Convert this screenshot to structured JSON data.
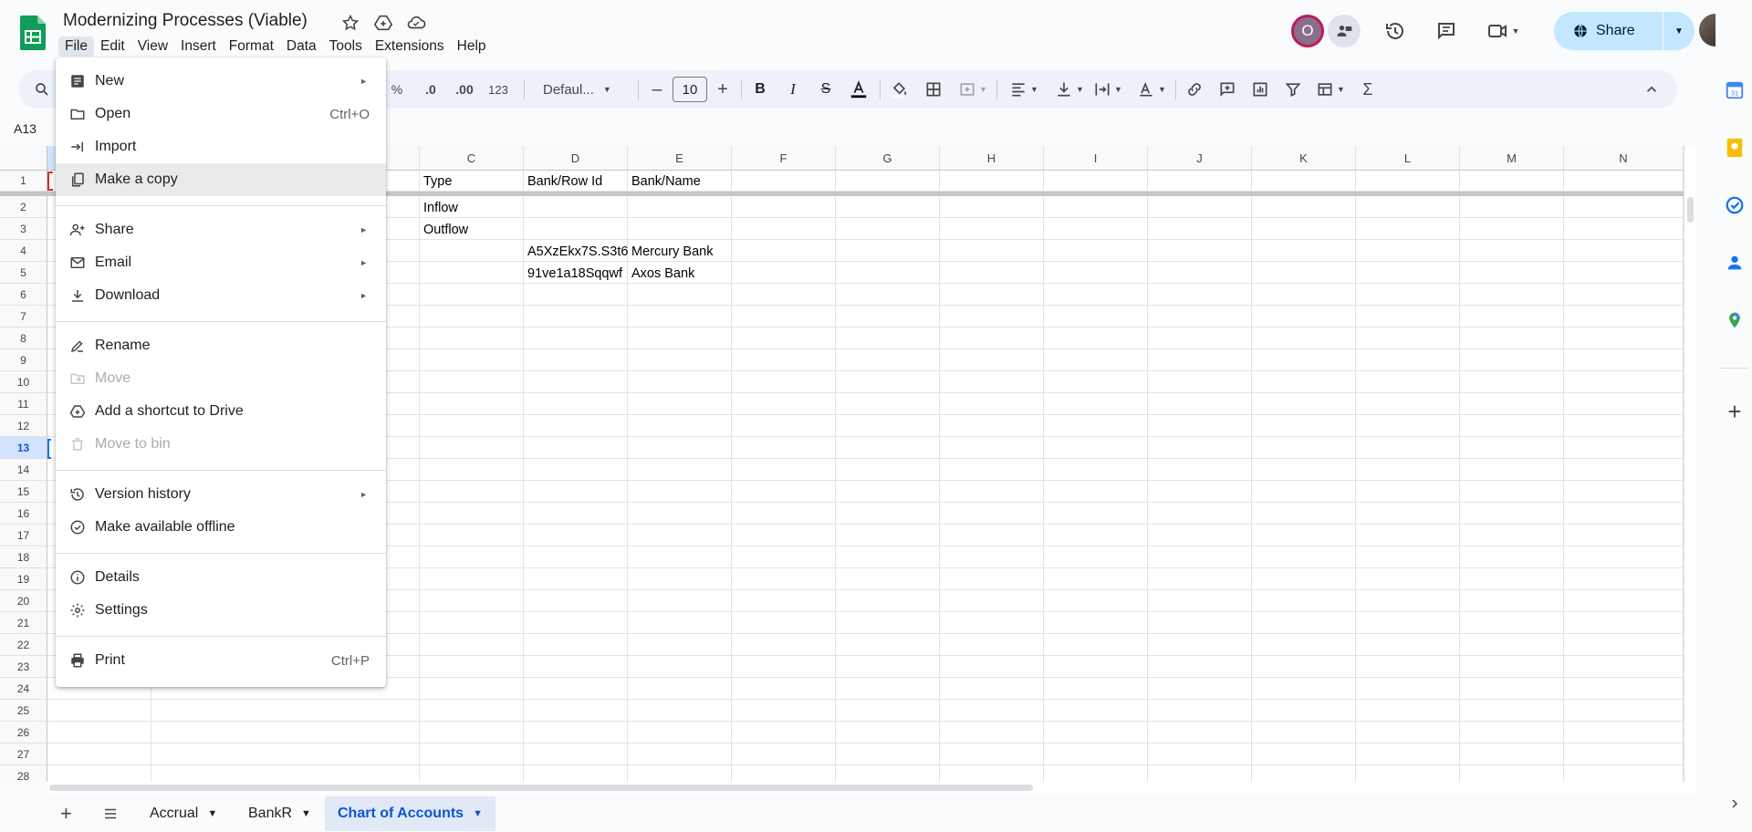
{
  "doc": {
    "title": "Modernizing Processes (Viable)"
  },
  "menubar": [
    "File",
    "Edit",
    "View",
    "Insert",
    "Format",
    "Data",
    "Tools",
    "Extensions",
    "Help"
  ],
  "header": {
    "avatar_letter": "O",
    "share_label": "Share"
  },
  "toolbar": {
    "percent": "%",
    "dec_decrease": ".0",
    "dec_increase": ".00",
    "number_format": "123",
    "font": "Defaul...",
    "font_size": "10"
  },
  "namebox": "A13",
  "columns": [
    "C",
    "D",
    "E",
    "F",
    "G",
    "H",
    "I",
    "J",
    "K",
    "L",
    "M",
    "N"
  ],
  "rows": [
    "1",
    "2",
    "3",
    "4",
    "5",
    "6",
    "7",
    "8",
    "9",
    "10",
    "11",
    "12",
    "13",
    "14",
    "15",
    "16",
    "17",
    "18",
    "19",
    "20",
    "21",
    "22",
    "23",
    "24",
    "25",
    "26",
    "27",
    "28"
  ],
  "cells": {
    "c1": "Type",
    "d1": "Bank/Row Id",
    "e1": "Bank/Name",
    "c2": "Inflow",
    "c3": "Outflow",
    "d4": "A5XzEkx7S.S3t6",
    "e4": "Mercury Bank",
    "d5": "91ve1a18Sqqwf",
    "e5": "Axos Bank"
  },
  "file_menu": {
    "new": "New",
    "open": "Open",
    "open_shortcut": "Ctrl+O",
    "import": "Import",
    "make_copy": "Make a copy",
    "share": "Share",
    "email": "Email",
    "download": "Download",
    "rename": "Rename",
    "move": "Move",
    "add_shortcut": "Add a shortcut to Drive",
    "move_to_bin": "Move to bin",
    "version_history": "Version history",
    "offline": "Make available offline",
    "details": "Details",
    "settings": "Settings",
    "print": "Print",
    "print_shortcut": "Ctrl+P"
  },
  "sheet_tabs": {
    "add": "+",
    "tab1": "Accrual",
    "tab2": "BankR",
    "tab3": "Chart of Accounts"
  },
  "colors": {
    "accent": "#0b57d0",
    "share_bg": "#c2e7ff",
    "sheets_green": "#0f9d58"
  }
}
